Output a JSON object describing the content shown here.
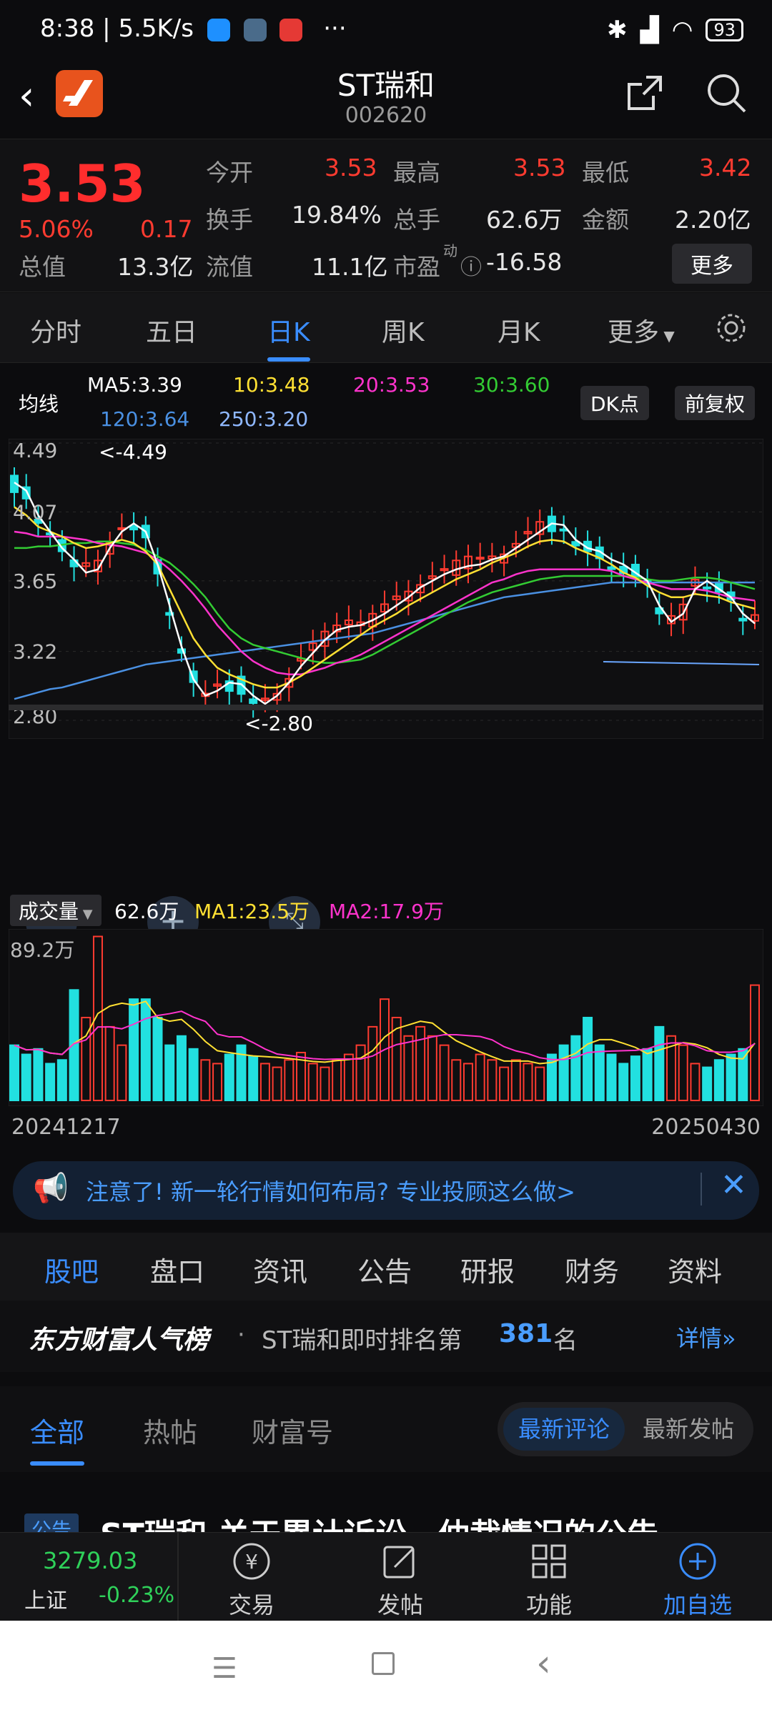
{
  "status": {
    "time": "8:38",
    "speed": "5.5K/s",
    "battery": "93",
    "dots": "···"
  },
  "header": {
    "title": "ST瑞和",
    "code": "002620"
  },
  "quote": {
    "price": "3.53",
    "pct": "5.06%",
    "chg": "0.17",
    "open_label": "今开",
    "open": "3.53",
    "high_label": "最高",
    "high": "3.53",
    "low_label": "最低",
    "low": "3.42",
    "turnover_label": "换手",
    "turnover": "19.84%",
    "volume_label": "总手",
    "volume": "62.6万",
    "amount_label": "金额",
    "amount": "2.20亿",
    "mktcap_label": "总值",
    "mktcap": "13.3亿",
    "float_label": "流值",
    "float": "11.1亿",
    "pe_label": "市盈",
    "pe_sup": "动",
    "pe": "-16.58",
    "more": "更多"
  },
  "ktabs": [
    "分时",
    "五日",
    "日K",
    "周K",
    "月K",
    "更多"
  ],
  "ma": {
    "label": "均线",
    "ma5": "MA5:3.39",
    "ma10": "10:3.48",
    "ma20": "20:3.53",
    "ma30": "30:3.60",
    "ma120": "120:3.64",
    "ma250": "250:3.20",
    "dk": "DK点",
    "fq": "前复权",
    "colors": {
      "ma5": "#ffffff",
      "ma10": "#ffe033",
      "ma20": "#ff33cc",
      "ma30": "#33cc33",
      "ma120": "#4a90e2",
      "ma250": "#8fb8ff"
    }
  },
  "chart_data": {
    "type": "candlestick",
    "ylim": [
      2.8,
      4.49
    ],
    "y_ticks": [
      "4.49",
      "4.07",
      "3.65",
      "3.22",
      "2.80"
    ],
    "high_marker": "<-4.49",
    "low_marker": "<-2.80",
    "x_start": "20241217",
    "x_end": "20250430",
    "ma5": [
      4.25,
      4.2,
      4.05,
      3.95,
      3.85,
      3.78,
      3.7,
      3.72,
      3.85,
      3.95,
      4.0,
      3.95,
      3.75,
      3.5,
      3.25,
      3.05,
      2.95,
      2.98,
      3.03,
      3.02,
      2.95,
      2.9,
      2.95,
      3.03,
      3.13,
      3.21,
      3.29,
      3.35,
      3.37,
      3.38,
      3.41,
      3.45,
      3.5,
      3.55,
      3.61,
      3.65,
      3.69,
      3.72,
      3.74,
      3.75,
      3.78,
      3.8,
      3.85,
      3.9,
      3.95,
      4.0,
      3.99,
      3.9,
      3.85,
      3.83,
      3.78,
      3.75,
      3.7,
      3.65,
      3.5,
      3.4,
      3.45,
      3.6,
      3.65,
      3.6,
      3.55,
      3.45,
      3.39
    ],
    "ma10": [
      4.1,
      4.05,
      3.98,
      3.95,
      3.92,
      3.88,
      3.85,
      3.86,
      3.88,
      3.9,
      3.88,
      3.83,
      3.75,
      3.6,
      3.45,
      3.3,
      3.2,
      3.12,
      3.08,
      3.05,
      3.02,
      3.0,
      3.0,
      3.03,
      3.07,
      3.12,
      3.17,
      3.22,
      3.27,
      3.32,
      3.37,
      3.41,
      3.45,
      3.5,
      3.54,
      3.58,
      3.62,
      3.66,
      3.69,
      3.72,
      3.76,
      3.79,
      3.82,
      3.86,
      3.89,
      3.9,
      3.89,
      3.85,
      3.82,
      3.79,
      3.75,
      3.7,
      3.67,
      3.62,
      3.58,
      3.55,
      3.55,
      3.57,
      3.56,
      3.55,
      3.52,
      3.5,
      3.48
    ],
    "ma20": [
      3.95,
      3.94,
      3.92,
      3.92,
      3.92,
      3.91,
      3.9,
      3.88,
      3.87,
      3.86,
      3.84,
      3.82,
      3.78,
      3.72,
      3.65,
      3.57,
      3.48,
      3.38,
      3.3,
      3.22,
      3.16,
      3.12,
      3.09,
      3.08,
      3.08,
      3.1,
      3.12,
      3.15,
      3.17,
      3.2,
      3.24,
      3.28,
      3.32,
      3.36,
      3.4,
      3.44,
      3.48,
      3.52,
      3.56,
      3.6,
      3.64,
      3.66,
      3.69,
      3.71,
      3.72,
      3.72,
      3.72,
      3.72,
      3.72,
      3.72,
      3.71,
      3.68,
      3.66,
      3.64,
      3.62,
      3.6,
      3.6,
      3.6,
      3.59,
      3.57,
      3.55,
      3.54,
      3.53
    ],
    "ma30": [
      3.85,
      3.85,
      3.86,
      3.86,
      3.87,
      3.88,
      3.88,
      3.89,
      3.89,
      3.88,
      3.87,
      3.84,
      3.8,
      3.76,
      3.7,
      3.63,
      3.55,
      3.45,
      3.36,
      3.3,
      3.26,
      3.24,
      3.22,
      3.2,
      3.18,
      3.16,
      3.15,
      3.15,
      3.16,
      3.17,
      3.2,
      3.24,
      3.28,
      3.32,
      3.36,
      3.4,
      3.44,
      3.48,
      3.52,
      3.55,
      3.58,
      3.6,
      3.62,
      3.64,
      3.66,
      3.67,
      3.68,
      3.68,
      3.68,
      3.68,
      3.68,
      3.68,
      3.67,
      3.66,
      3.65,
      3.65,
      3.66,
      3.67,
      3.67,
      3.66,
      3.64,
      3.62,
      3.6
    ],
    "ma120": [
      2.93,
      2.95,
      2.97,
      2.99,
      3.0,
      3.02,
      3.04,
      3.06,
      3.08,
      3.1,
      3.12,
      3.14,
      3.15,
      3.16,
      3.17,
      3.18,
      3.19,
      3.2,
      3.21,
      3.22,
      3.23,
      3.24,
      3.25,
      3.26,
      3.27,
      3.28,
      3.29,
      3.3,
      3.31,
      3.32,
      3.33,
      3.35,
      3.37,
      3.39,
      3.41,
      3.43,
      3.45,
      3.47,
      3.49,
      3.51,
      3.53,
      3.55,
      3.56,
      3.57,
      3.58,
      3.59,
      3.6,
      3.61,
      3.62,
      3.63,
      3.64,
      3.64,
      3.64,
      3.64,
      3.64,
      3.64,
      3.64,
      3.64,
      3.64,
      3.64,
      3.64,
      3.64,
      3.64
    ],
    "vol_max_label": "89.2万",
    "vol_label": "成交量",
    "vol_value": "62.6万",
    "vol_ma1": "MA1:23.5万",
    "vol_ma2": "MA2:17.9万",
    "volumes": [
      30,
      25,
      28,
      20,
      22,
      60,
      45,
      89,
      40,
      30,
      55,
      55,
      45,
      30,
      35,
      28,
      22,
      20,
      25,
      30,
      24,
      20,
      18,
      22,
      26,
      20,
      18,
      22,
      25,
      30,
      40,
      55,
      45,
      35,
      40,
      35,
      30,
      22,
      20,
      25,
      22,
      18,
      22,
      20,
      18,
      25,
      30,
      35,
      45,
      30,
      25,
      20,
      24,
      28,
      40,
      35,
      30,
      20,
      18,
      22,
      25,
      28,
      62.6
    ]
  },
  "notice": {
    "text": "注意了! 新一轮行情如何布局? 专业投顾这么做>"
  },
  "subtabs": [
    "股吧",
    "盘口",
    "资讯",
    "公告",
    "研报",
    "财务",
    "资料"
  ],
  "rank": {
    "brand": "东方财富人气榜",
    "text": "ST瑞和即时排名第",
    "num": "381",
    "unit": "名",
    "detail": "详情"
  },
  "feedtabs": [
    "全部",
    "热帖",
    "财富号"
  ],
  "feedsort": {
    "on": "最新评论",
    "off": "最新发帖"
  },
  "postpeek": {
    "tag": "公告",
    "title": "ST瑞和 关于累计诉讼、仲裁情况的公告"
  },
  "bottombar": {
    "index_value": "3279.03",
    "index_name": "上证",
    "index_pct": "-0.23%",
    "trade": "交易",
    "post": "发帖",
    "func": "功能",
    "add": "加自选"
  }
}
